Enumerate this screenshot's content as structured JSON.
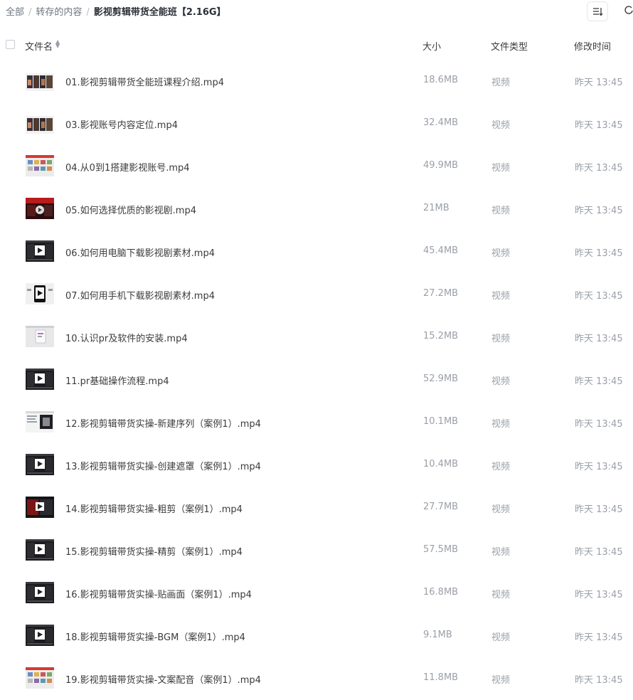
{
  "breadcrumb": {
    "root": "全部",
    "parent": "转存的内容",
    "current": "影视剪辑带货全能班【2.16G】",
    "separator": "/"
  },
  "toolbar": {
    "sort_icon": "sort-icon"
  },
  "table": {
    "headers": {
      "name": "文件名",
      "size": "大小",
      "type": "文件类型",
      "modified": "修改时间"
    },
    "rows": [
      {
        "name": "01.影视剪辑带货全能班课程介绍.mp4",
        "size": "18.6MB",
        "type": "视频",
        "modified": "昨天 13:45",
        "thumb": "gallery"
      },
      {
        "name": "03.影视账号内容定位.mp4",
        "size": "32.4MB",
        "type": "视频",
        "modified": "昨天 13:45",
        "thumb": "gallery"
      },
      {
        "name": "04.从0到1搭建影视账号.mp4",
        "size": "49.9MB",
        "type": "视频",
        "modified": "昨天 13:45",
        "thumb": "grid"
      },
      {
        "name": "05.如何选择优质的影视剧.mp4",
        "size": "21MB",
        "type": "视频",
        "modified": "昨天 13:45",
        "thumb": "red"
      },
      {
        "name": "06.如何用电脑下载影视剧素材.mp4",
        "size": "45.4MB",
        "type": "视频",
        "modified": "昨天 13:45",
        "thumb": "dark"
      },
      {
        "name": "07.如何用手机下载影视剧素材.mp4",
        "size": "27.2MB",
        "type": "视频",
        "modified": "昨天 13:45",
        "thumb": "phone"
      },
      {
        "name": "10.认识pr及软件的安装.mp4",
        "size": "15.2MB",
        "type": "视频",
        "modified": "昨天 13:45",
        "thumb": "light"
      },
      {
        "name": "11.pr基础操作流程.mp4",
        "size": "52.9MB",
        "type": "视频",
        "modified": "昨天 13:45",
        "thumb": "dark"
      },
      {
        "name": "12.影视剪辑带货实操-新建序列（案例1）.mp4",
        "size": "10.1MB",
        "type": "视频",
        "modified": "昨天 13:45",
        "thumb": "split"
      },
      {
        "name": "13.影视剪辑带货实操-创建遮罩（案例1）.mp4",
        "size": "10.4MB",
        "type": "视频",
        "modified": "昨天 13:45",
        "thumb": "dark"
      },
      {
        "name": "14.影视剪辑带货实操-粗剪（案例1）.mp4",
        "size": "27.7MB",
        "type": "视频",
        "modified": "昨天 13:45",
        "thumb": "redish"
      },
      {
        "name": "15.影视剪辑带货实操-精剪（案例1）.mp4",
        "size": "57.5MB",
        "type": "视频",
        "modified": "昨天 13:45",
        "thumb": "dark"
      },
      {
        "name": "16.影视剪辑带货实操-贴画面（案例1）.mp4",
        "size": "16.8MB",
        "type": "视频",
        "modified": "昨天 13:45",
        "thumb": "dark"
      },
      {
        "name": "18.影视剪辑带货实操-BGM（案例1）.mp4",
        "size": "9.1MB",
        "type": "视频",
        "modified": "昨天 13:45",
        "thumb": "dark"
      },
      {
        "name": "19.影视剪辑带货实操-文案配音（案例1）.mp4",
        "size": "11.8MB",
        "type": "视频",
        "modified": "昨天 13:45",
        "thumb": "grid"
      }
    ]
  }
}
